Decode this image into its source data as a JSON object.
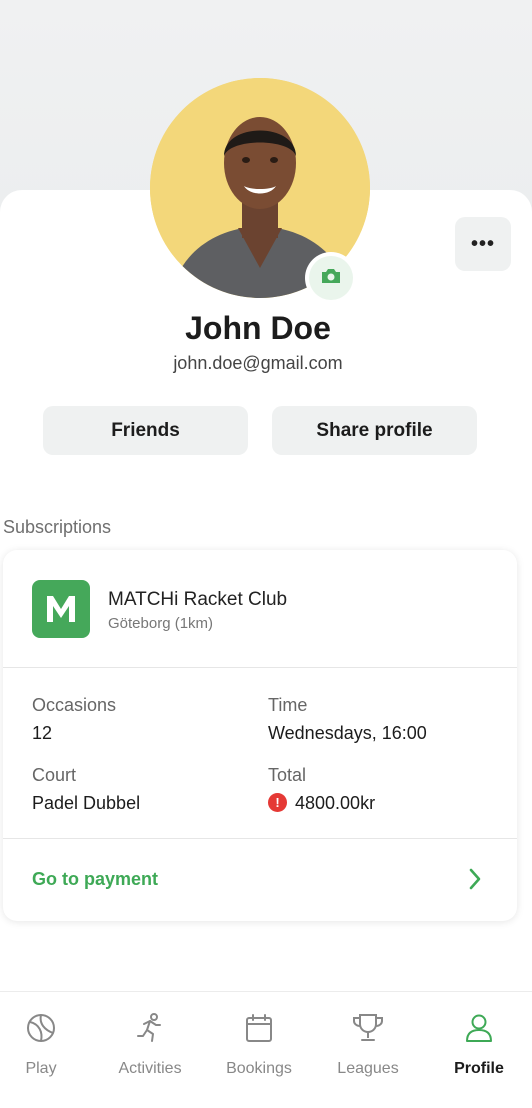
{
  "profile": {
    "name": "John Doe",
    "email": "john.doe@gmail.com",
    "more_label": "•••"
  },
  "actions": {
    "friends_label": "Friends",
    "share_label": "Share profile"
  },
  "subscriptions": {
    "section_label": "Subscriptions",
    "club": {
      "logo_letter": "M",
      "name": "MATCHi Racket Club",
      "location": "Göteborg (1km)"
    },
    "details": {
      "occasions_label": "Occasions",
      "occasions_value": "12",
      "time_label": "Time",
      "time_value": "Wednesdays, 16:00",
      "court_label": "Court",
      "court_value": "Padel Dubbel",
      "total_label": "Total",
      "total_value": "4800.00kr"
    },
    "payment_link": "Go to payment"
  },
  "nav": {
    "items": [
      {
        "label": "Play",
        "icon": "tennis-ball-icon"
      },
      {
        "label": "Activities",
        "icon": "running-person-icon"
      },
      {
        "label": "Bookings",
        "icon": "calendar-icon"
      },
      {
        "label": "Leagues",
        "icon": "trophy-icon"
      },
      {
        "label": "Profile",
        "icon": "person-icon",
        "active": true
      }
    ]
  },
  "colors": {
    "accent": "#3ea956",
    "logo_green": "#45a85a",
    "alert_red": "#e53935",
    "avatar_bg": "#f3d77a"
  }
}
